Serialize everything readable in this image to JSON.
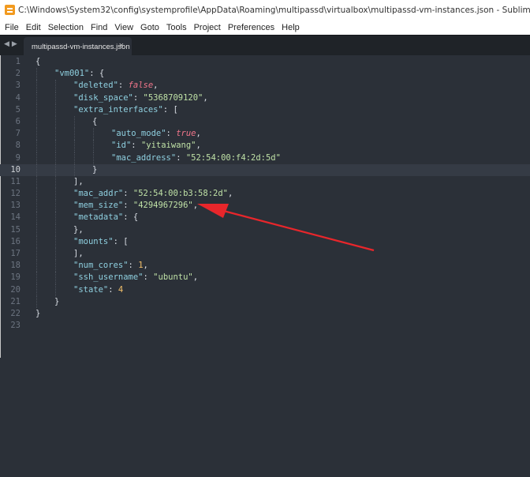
{
  "window": {
    "title": "C:\\Windows\\System32\\config\\systemprofile\\AppData\\Roaming\\multipassd\\virtualbox\\multipassd-vm-instances.json - Sublime Text (UNREGISTERED)"
  },
  "menu": [
    "File",
    "Edit",
    "Selection",
    "Find",
    "View",
    "Goto",
    "Tools",
    "Project",
    "Preferences",
    "Help"
  ],
  "tab": {
    "label": "multipassd-vm-instances.json",
    "close": "×"
  },
  "editor": {
    "current_line": 10,
    "lines": [
      {
        "n": "1",
        "indent": 0,
        "tokens": [
          [
            "p",
            "{"
          ]
        ]
      },
      {
        "n": "2",
        "indent": 1,
        "tokens": [
          [
            "k",
            "\"vm001\""
          ],
          [
            "p",
            ": {"
          ]
        ]
      },
      {
        "n": "3",
        "indent": 2,
        "tokens": [
          [
            "k",
            "\"deleted\""
          ],
          [
            "p",
            ": "
          ],
          [
            "f",
            "false"
          ],
          [
            "p",
            ","
          ]
        ]
      },
      {
        "n": "4",
        "indent": 2,
        "tokens": [
          [
            "k",
            "\"disk_space\""
          ],
          [
            "p",
            ": "
          ],
          [
            "s",
            "\"5368709120\""
          ],
          [
            "p",
            ","
          ]
        ]
      },
      {
        "n": "5",
        "indent": 2,
        "tokens": [
          [
            "k",
            "\"extra_interfaces\""
          ],
          [
            "p",
            ": ["
          ]
        ]
      },
      {
        "n": "6",
        "indent": 3,
        "tokens": [
          [
            "p",
            "{"
          ]
        ]
      },
      {
        "n": "7",
        "indent": 4,
        "tokens": [
          [
            "k",
            "\"auto_mode\""
          ],
          [
            "p",
            ": "
          ],
          [
            "f",
            "true"
          ],
          [
            "p",
            ","
          ]
        ]
      },
      {
        "n": "8",
        "indent": 4,
        "tokens": [
          [
            "k",
            "\"id\""
          ],
          [
            "p",
            ": "
          ],
          [
            "s",
            "\"yitaiwang\""
          ],
          [
            "p",
            ","
          ]
        ]
      },
      {
        "n": "9",
        "indent": 4,
        "tokens": [
          [
            "k",
            "\"mac_address\""
          ],
          [
            "p",
            ": "
          ],
          [
            "s",
            "\"52:54:00:f4:2d:5d\""
          ]
        ]
      },
      {
        "n": "10",
        "indent": 3,
        "tokens": [
          [
            "p",
            "}"
          ]
        ]
      },
      {
        "n": "11",
        "indent": 2,
        "tokens": [
          [
            "p",
            "],"
          ]
        ]
      },
      {
        "n": "12",
        "indent": 2,
        "tokens": [
          [
            "k",
            "\"mac_addr\""
          ],
          [
            "p",
            ": "
          ],
          [
            "s",
            "\"52:54:00:b3:58:2d\""
          ],
          [
            "p",
            ","
          ]
        ]
      },
      {
        "n": "13",
        "indent": 2,
        "tokens": [
          [
            "k",
            "\"mem_size\""
          ],
          [
            "p",
            ": "
          ],
          [
            "s",
            "\"4294967296\""
          ],
          [
            "p",
            ","
          ]
        ]
      },
      {
        "n": "14",
        "indent": 2,
        "tokens": [
          [
            "k",
            "\"metadata\""
          ],
          [
            "p",
            ": {"
          ]
        ]
      },
      {
        "n": "15",
        "indent": 2,
        "tokens": [
          [
            "p",
            "},"
          ]
        ]
      },
      {
        "n": "16",
        "indent": 2,
        "tokens": [
          [
            "k",
            "\"mounts\""
          ],
          [
            "p",
            ": ["
          ]
        ]
      },
      {
        "n": "17",
        "indent": 2,
        "tokens": [
          [
            "p",
            "],"
          ]
        ]
      },
      {
        "n": "18",
        "indent": 2,
        "tokens": [
          [
            "k",
            "\"num_cores\""
          ],
          [
            "p",
            ": "
          ],
          [
            "n",
            "1"
          ],
          [
            "p",
            ","
          ]
        ]
      },
      {
        "n": "19",
        "indent": 2,
        "tokens": [
          [
            "k",
            "\"ssh_username\""
          ],
          [
            "p",
            ": "
          ],
          [
            "s",
            "\"ubuntu\""
          ],
          [
            "p",
            ","
          ]
        ]
      },
      {
        "n": "20",
        "indent": 2,
        "tokens": [
          [
            "k",
            "\"state\""
          ],
          [
            "p",
            ": "
          ],
          [
            "n",
            "4"
          ]
        ]
      },
      {
        "n": "21",
        "indent": 1,
        "tokens": [
          [
            "p",
            "}"
          ]
        ]
      },
      {
        "n": "22",
        "indent": 0,
        "tokens": [
          [
            "p",
            "}"
          ]
        ]
      },
      {
        "n": "23",
        "indent": 0,
        "tokens": []
      }
    ]
  },
  "annotation": {
    "type": "red-arrow",
    "color": "#e8262b",
    "points_to": "mem_size"
  },
  "colors": {
    "editor_bg": "#2b3038",
    "tab_bar_bg": "#1f2328",
    "key": "#8fd0e0",
    "string": "#bfe1a6",
    "boolean": "#f0758a",
    "number": "#f3c06b",
    "app_icon": "#f29a1f"
  }
}
